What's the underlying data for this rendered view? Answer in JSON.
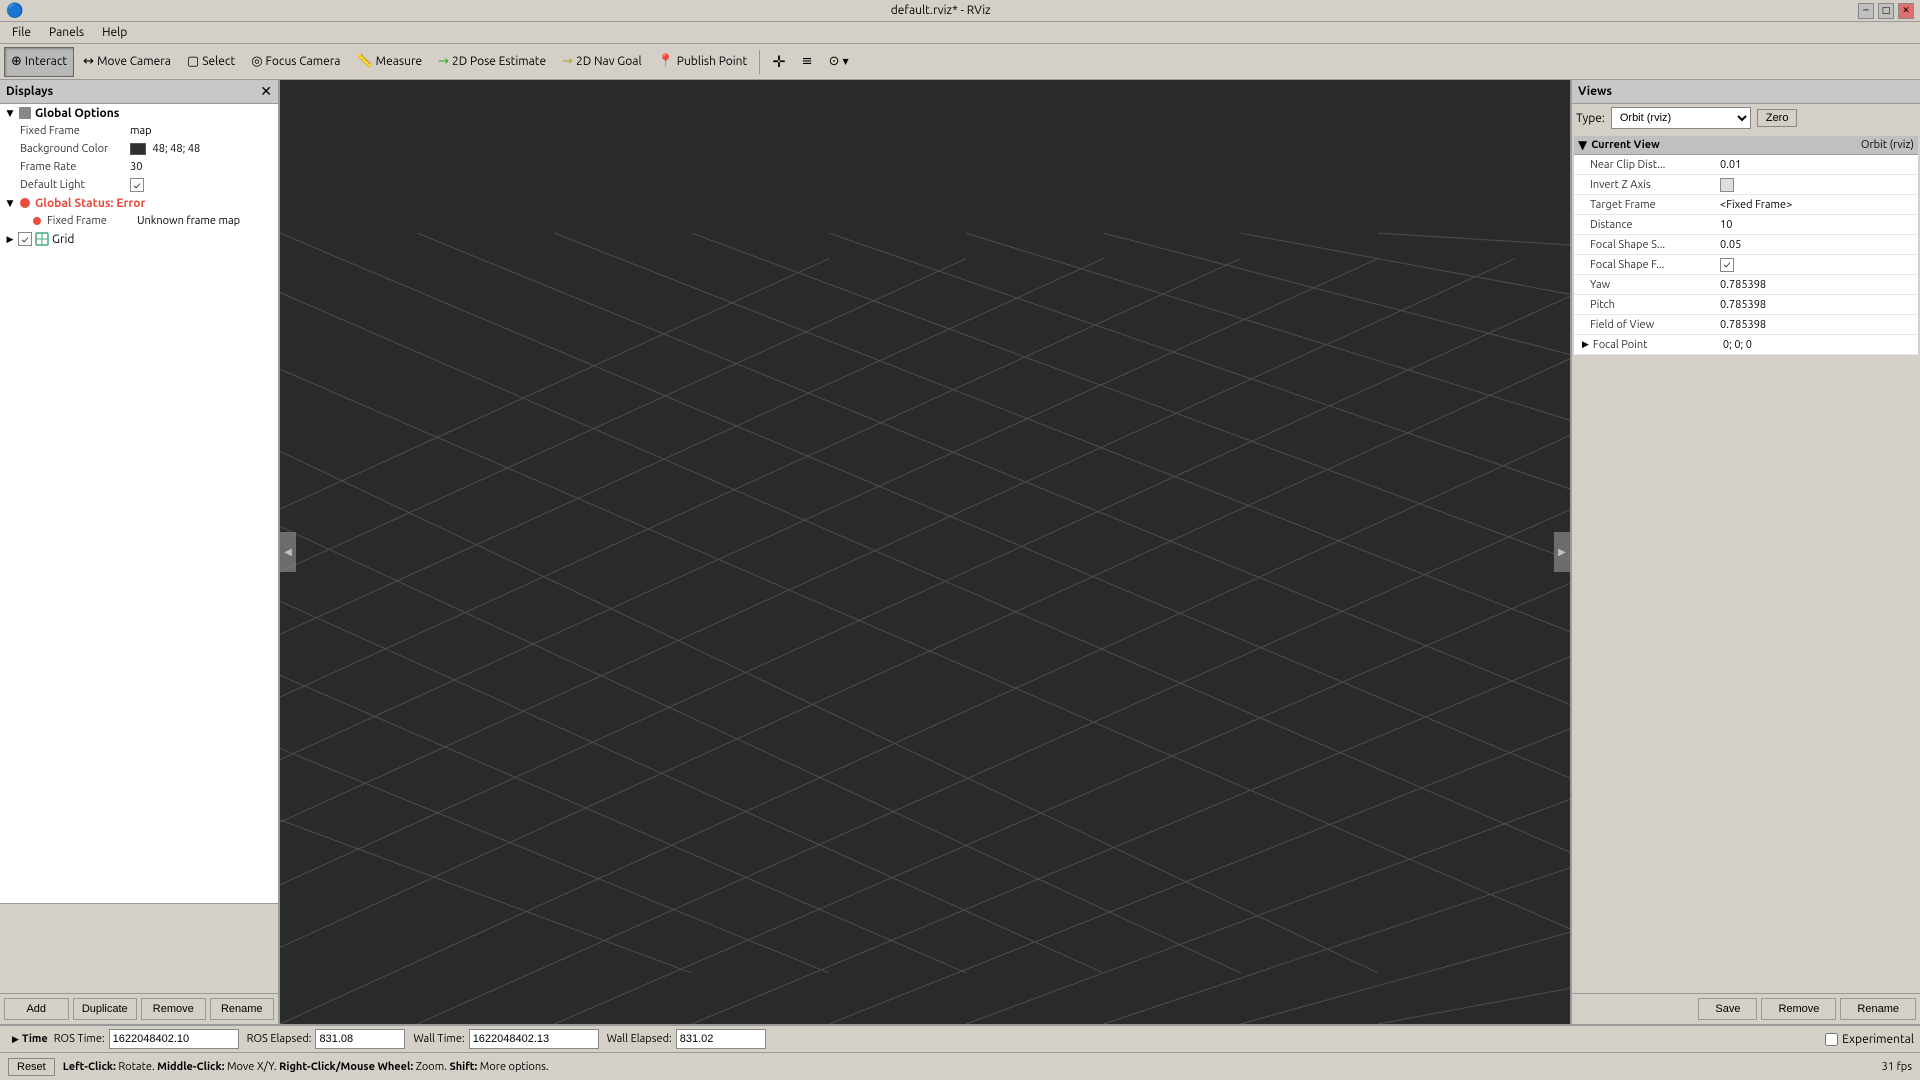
{
  "titlebar": {
    "title": "default.rviz* - RViz",
    "app_icon": "●",
    "minimize": "─",
    "maximize": "□",
    "close": "✕"
  },
  "menubar": {
    "items": [
      "File",
      "Panels",
      "Help"
    ]
  },
  "toolbar": {
    "interact": "Interact",
    "move_camera": "Move Camera",
    "select": "Select",
    "focus_camera": "Focus Camera",
    "measure": "Measure",
    "pose_estimate": "2D Pose Estimate",
    "nav_goal": "2D Nav Goal",
    "publish_point": "Publish Point"
  },
  "displays": {
    "header": "Displays",
    "global_options": {
      "label": "Global Options",
      "fixed_frame_label": "Fixed Frame",
      "fixed_frame_value": "map",
      "background_color_label": "Background Color",
      "background_color_value": "48; 48; 48",
      "frame_rate_label": "Frame Rate",
      "frame_rate_value": "30",
      "default_light_label": "Default Light",
      "default_light_checked": true
    },
    "global_status": {
      "label": "Global Status: Error",
      "fixed_frame_label": "Fixed Frame",
      "fixed_frame_value": "Unknown frame map"
    },
    "grid": {
      "label": "Grid",
      "checked": true
    },
    "buttons": {
      "add": "Add",
      "duplicate": "Duplicate",
      "remove": "Remove",
      "rename": "Rename"
    }
  },
  "views": {
    "header": "Views",
    "type_label": "Type:",
    "type_value": "Orbit (rviz)",
    "zero_btn": "Zero",
    "current_view": {
      "header": "Current View",
      "type_label": "Orbit (rviz)",
      "near_clip_dist_label": "Near Clip Dist...",
      "near_clip_dist_value": "0.01",
      "invert_z_axis_label": "Invert Z Axis",
      "invert_z_axis_checked": false,
      "target_frame_label": "Target Frame",
      "target_frame_value": "<Fixed Frame>",
      "distance_label": "Distance",
      "distance_value": "10",
      "focal_shape_size_label": "Focal Shape S...",
      "focal_shape_size_value": "0.05",
      "focal_shape_fixed_label": "Focal Shape F...",
      "focal_shape_fixed_checked": true,
      "yaw_label": "Yaw",
      "yaw_value": "0.785398",
      "pitch_label": "Pitch",
      "pitch_value": "0.785398",
      "field_of_view_label": "Field of View",
      "field_of_view_value": "0.785398",
      "focal_point_label": "Focal Point",
      "focal_point_value": "0; 0; 0"
    },
    "buttons": {
      "save": "Save",
      "remove": "Remove",
      "rename": "Rename"
    }
  },
  "time": {
    "header": "Time",
    "ros_time_label": "ROS Time:",
    "ros_time_value": "1622048402.10",
    "ros_elapsed_label": "ROS Elapsed:",
    "ros_elapsed_value": "831.08",
    "wall_time_label": "Wall Time:",
    "wall_time_value": "1622048402.13",
    "wall_elapsed_label": "Wall Elapsed:",
    "wall_elapsed_value": "831.02",
    "experimental_label": "Experimental"
  },
  "statusbar": {
    "reset_label": "Reset",
    "status_text": "Left-Click: Rotate.  Middle-Click: Move X/Y.  Right-Click/Mouse Wheel: Zoom.  Shift: More options.",
    "left_click": "Left-Click:",
    "left_click_action": "Rotate.",
    "middle_click": "Middle-Click:",
    "middle_click_action": "Move X/Y.",
    "right_click": "Right-Click/Mouse Wheel:",
    "right_click_action": "Zoom.",
    "shift": "Shift:",
    "shift_action": "More options.",
    "fps": "31 fps"
  }
}
